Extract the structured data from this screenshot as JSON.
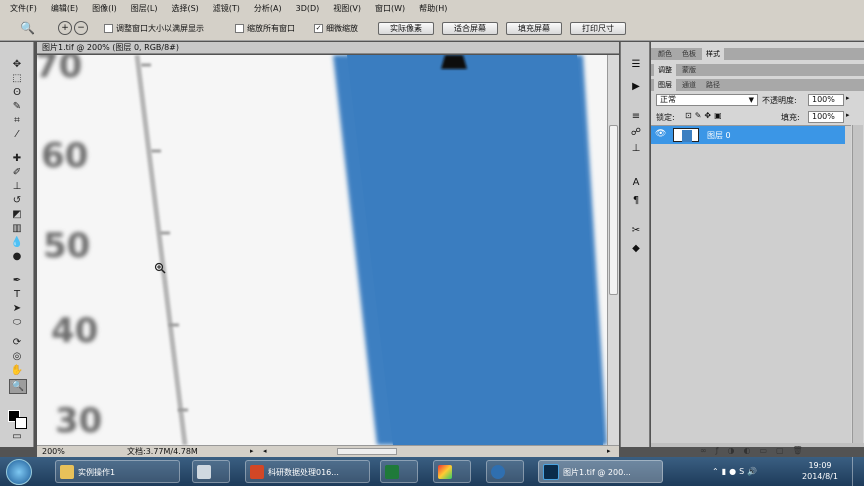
{
  "menu": [
    "文件(F)",
    "编辑(E)",
    "图像(I)",
    "图层(L)",
    "选择(S)",
    "滤镜(T)",
    "分析(A)",
    "3D(D)",
    "视图(V)",
    "窗口(W)",
    "帮助(H)"
  ],
  "options": {
    "chk1": "调整窗口大小以满屏显示",
    "chk2": "缩放所有窗口",
    "chk3": "细微缩放",
    "btn1": "实际像素",
    "btn2": "适合屏幕",
    "btn3": "填充屏幕",
    "btn4": "打印尺寸"
  },
  "document": {
    "tab": "图片1.tif @ 200% (图层 0, RGB/8#)",
    "labels": [
      "70",
      "60",
      "50",
      "40",
      "30"
    ]
  },
  "status": {
    "zoom": "200%",
    "info": "文档:3.77M/4.78M"
  },
  "panels": {
    "top_tabs": [
      "颜色",
      "色板",
      "样式"
    ],
    "mid_tabs": [
      "调整",
      "蒙版"
    ],
    "layer_tabs": [
      "图层",
      "通道",
      "路径"
    ],
    "blend_mode": "正常",
    "opacity_label": "不透明度:",
    "opacity": "100%",
    "lock_label": "锁定:",
    "fill_label": "填充:",
    "fill": "100%",
    "layer_name": "图层 0"
  },
  "taskbar": {
    "items": [
      "实例操作1",
      "科研数据处理016...",
      "图片1.tif @ 200..."
    ],
    "time": "19:09",
    "date": "2014/8/1"
  },
  "colors": {
    "blue_band": "#3c7fc1",
    "selection": "#3b96e6"
  }
}
